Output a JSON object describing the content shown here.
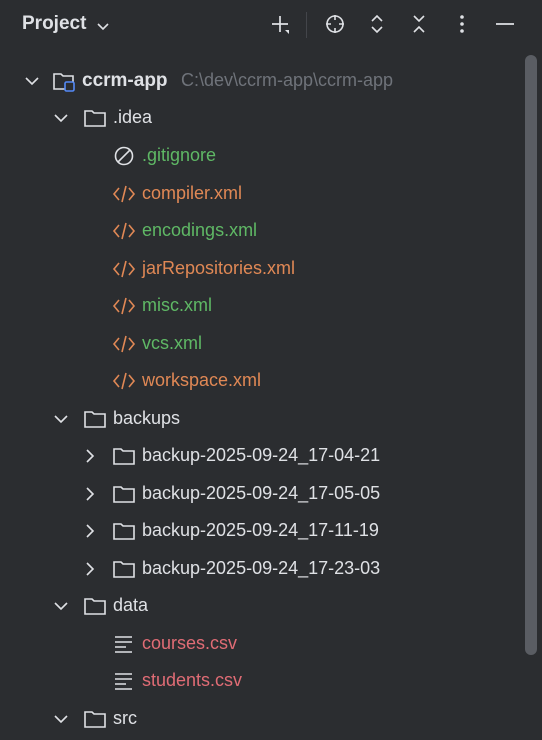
{
  "header": {
    "title": "Project",
    "toolbar": [
      "add-icon",
      "locate-icon",
      "expand-all-icon",
      "collapse-all-icon",
      "more-icon",
      "hide-icon"
    ]
  },
  "tree": {
    "root": {
      "name": "ccrm-app",
      "path": "C:\\dev\\ccrm-app\\ccrm-app"
    },
    "idea": {
      "name": ".idea",
      "files": [
        {
          "name": ".gitignore",
          "color": "#5fb865",
          "icon": "ignored-file-icon"
        },
        {
          "name": "compiler.xml",
          "color": "#e08855",
          "icon": "xml-file-icon"
        },
        {
          "name": "encodings.xml",
          "color": "#5fb865",
          "icon": "xml-file-icon"
        },
        {
          "name": "jarRepositories.xml",
          "color": "#e08855",
          "icon": "xml-file-icon"
        },
        {
          "name": "misc.xml",
          "color": "#5fb865",
          "icon": "xml-file-icon"
        },
        {
          "name": "vcs.xml",
          "color": "#5fb865",
          "icon": "xml-file-icon"
        },
        {
          "name": "workspace.xml",
          "color": "#e08855",
          "icon": "xml-file-icon"
        }
      ]
    },
    "backups": {
      "name": "backups",
      "folders": [
        "backup-2025-09-24_17-04-21",
        "backup-2025-09-24_17-05-05",
        "backup-2025-09-24_17-11-19",
        "backup-2025-09-24_17-23-03"
      ]
    },
    "data": {
      "name": "data",
      "files": [
        {
          "name": "courses.csv",
          "color": "#e06c75",
          "icon": "text-file-icon"
        },
        {
          "name": "students.csv",
          "color": "#e06c75",
          "icon": "text-file-icon"
        }
      ]
    },
    "src": {
      "name": "src"
    }
  }
}
